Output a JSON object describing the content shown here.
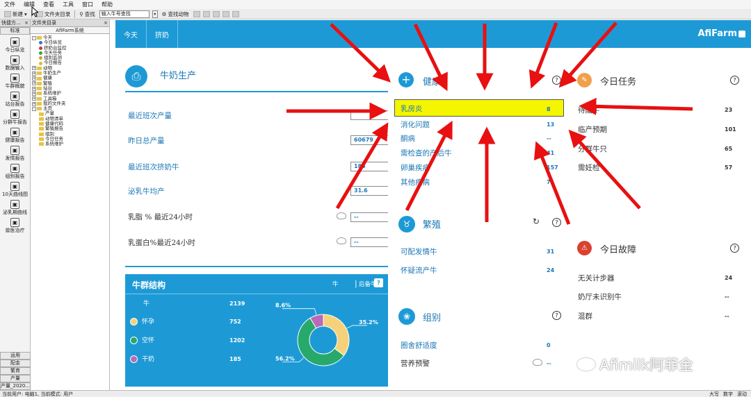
{
  "menu": [
    "文件",
    "编辑",
    "查看",
    "工具",
    "窗口",
    "帮助"
  ],
  "toolbar": {
    "new_label": "新建",
    "folder_label": "文件夹目录",
    "find_label": "查找",
    "search_placeholder": "输入牛号查找",
    "find_animal_label": "查找动物"
  },
  "quick_panel": {
    "title": "快捷方...",
    "category": "标准",
    "items": [
      {
        "icon": "today-icon",
        "label": "今日纵览"
      },
      {
        "icon": "data-input-icon",
        "label": "数据输入"
      },
      {
        "icon": "herd-overview-icon",
        "label": "牛群概貌"
      },
      {
        "icon": "station-report-icon",
        "label": "站台报告"
      },
      {
        "icon": "group-report-icon",
        "label": "分群牛报告"
      },
      {
        "icon": "health-report-icon",
        "label": "健康报告"
      },
      {
        "icon": "heat-report-icon",
        "label": "发情报告"
      },
      {
        "icon": "group-report2-icon",
        "label": "组别报告"
      },
      {
        "icon": "curve-icon",
        "label": "10天曲线图"
      },
      {
        "icon": "lactation-curve-icon",
        "label": "泌乳期曲线"
      },
      {
        "icon": "vet-icon",
        "label": "兽医治疗"
      }
    ],
    "bottom": [
      "运用",
      "配金",
      "繁育",
      "产量",
      "产量_2020..."
    ]
  },
  "folder_panel": {
    "title": "文件夹目录",
    "system": "AfiFarm系统",
    "tree": [
      {
        "level": 0,
        "toggle": "-",
        "label": "今天"
      },
      {
        "level": 1,
        "label": "今日纵览",
        "icon": "#2a7bd2"
      },
      {
        "level": 1,
        "label": "挤奶台监控",
        "icon": "#d23a2a"
      },
      {
        "level": 1,
        "label": "今天任务",
        "icon": "#2aa84a"
      },
      {
        "level": 1,
        "label": "组别监测",
        "icon": "#d2a02a"
      },
      {
        "level": 1,
        "label": "今日报告",
        "icon": "#d2c02a"
      },
      {
        "level": 0,
        "toggle": "+",
        "label": "动物"
      },
      {
        "level": 0,
        "toggle": "+",
        "label": "牛奶生产"
      },
      {
        "level": 0,
        "toggle": "+",
        "label": "健康"
      },
      {
        "level": 0,
        "toggle": "+",
        "label": "繁殖"
      },
      {
        "level": 0,
        "toggle": "+",
        "label": "站台"
      },
      {
        "level": 0,
        "toggle": "+",
        "label": "系统维护"
      },
      {
        "level": 0,
        "toggle": "+",
        "label": "工具箱"
      },
      {
        "level": 0,
        "toggle": "+",
        "label": "我的文件夹"
      },
      {
        "level": 0,
        "toggle": "-",
        "label": "主页"
      },
      {
        "level": 1,
        "label": "产量"
      },
      {
        "level": 1,
        "label": "动物清单"
      },
      {
        "level": 1,
        "label": "健康代码"
      },
      {
        "level": 1,
        "label": "繁殖报告"
      },
      {
        "level": 1,
        "label": "组别"
      },
      {
        "level": 1,
        "label": "今日任务"
      },
      {
        "level": 1,
        "label": "系统维护"
      }
    ]
  },
  "tabs": [
    "今天",
    "挤奶"
  ],
  "brand": "AfiFarm",
  "milk": {
    "title": "牛奶生产",
    "rows": [
      {
        "label": "最近班次产量",
        "value": ""
      },
      {
        "label": "昨日总产量",
        "value": "60679"
      },
      {
        "label": "最近班次挤奶牛",
        "value": "185"
      },
      {
        "label": "泌乳牛均产",
        "value": "31.6"
      },
      {
        "label": "乳脂 % 最近24小时",
        "value": "--"
      },
      {
        "label": "乳蛋白%最近24小时",
        "value": "--"
      }
    ]
  },
  "herd": {
    "title": "牛群结构",
    "tab_cow": "牛",
    "tab_heifer": "后备牛",
    "rows": [
      {
        "label": "牛",
        "value": "2139"
      },
      {
        "label": "怀孕",
        "value": "752",
        "color": "#f5d27a"
      },
      {
        "label": "空怀",
        "value": "1202",
        "color": "#27a96c"
      },
      {
        "label": "干奶",
        "value": "185",
        "color": "#b86ab8"
      }
    ]
  },
  "chart_data": {
    "type": "pie",
    "categories": [
      "怀孕",
      "空怀",
      "干奶"
    ],
    "values": [
      35.2,
      56.2,
      8.6
    ],
    "data_labels": [
      "35.2%",
      "56.2%",
      "8.6%"
    ],
    "colors": [
      "#f5d27a",
      "#27a96c",
      "#b86ab8"
    ],
    "donut": true
  },
  "health": {
    "title": "健康",
    "highlight_label": "乳房炎",
    "highlight_value": "8",
    "rows": [
      {
        "label": "消化问题",
        "value": "13"
      },
      {
        "label": "酮病",
        "value": "--"
      },
      {
        "label": "需检查的产后牛",
        "value": "41"
      },
      {
        "label": "卵巢疾病",
        "value": "157"
      },
      {
        "label": "其他疾病",
        "value": "7"
      }
    ]
  },
  "breeding": {
    "title": "繁殖",
    "rows": [
      {
        "label": "可配发情牛",
        "value": "31"
      },
      {
        "label": "怀疑流产牛",
        "value": "24"
      }
    ]
  },
  "groups": {
    "title": "组别",
    "rows": [
      {
        "label": "圈舍舒适度",
        "value": "0"
      },
      {
        "label": "营养预警",
        "value": "--"
      }
    ]
  },
  "tasks": {
    "title": "今日任务",
    "rows": [
      {
        "label": "待配牛",
        "value": "23"
      },
      {
        "label": "临产预期",
        "value": "101"
      },
      {
        "label": "分群牛只",
        "value": "65"
      },
      {
        "label": "需妊检",
        "value": "57"
      }
    ]
  },
  "faults": {
    "title": "今日故障",
    "rows": [
      {
        "label": "无关计步器",
        "value": "24"
      },
      {
        "label": "奶厅未识别牛",
        "value": "--"
      },
      {
        "label": "混群",
        "value": "--"
      }
    ]
  },
  "statusbar": {
    "left": "当前用户: 电脑1, 当前模式: 用户",
    "caps": "大写",
    "num": "数字",
    "scroll": "滚动"
  },
  "watermark": "Afimilk阿菲金"
}
